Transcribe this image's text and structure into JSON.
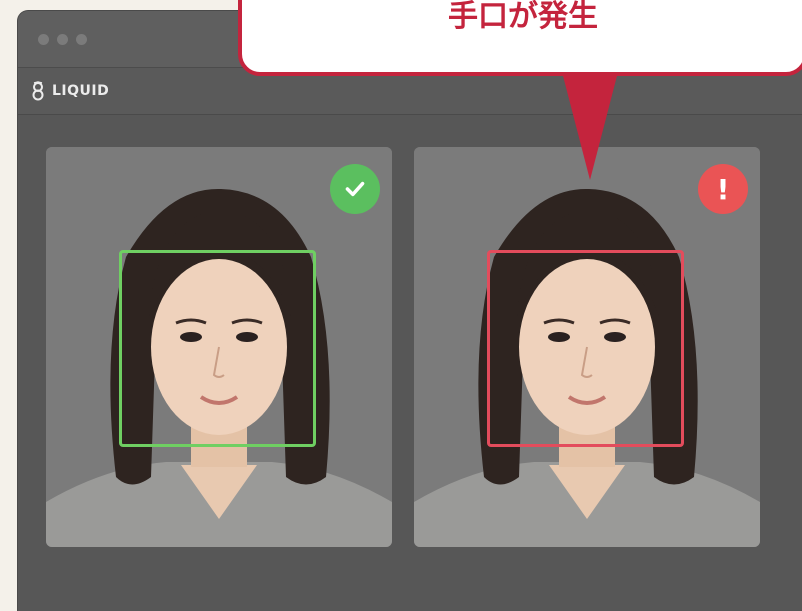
{
  "window": {
    "traffic_lights": [
      "window-dot",
      "window-dot",
      "window-dot"
    ]
  },
  "app": {
    "brand_label": "LIQUID",
    "brand_icon": "liquid-logo-icon"
  },
  "callout": {
    "text": "手口が発生",
    "color": "#c4243d"
  },
  "cards": [
    {
      "status": "ok",
      "badge_icon": "check-icon",
      "badge_color": "#5bbf5f",
      "frame_color": "#6fcf62"
    },
    {
      "status": "alert",
      "badge_icon": "exclamation-icon",
      "badge_text": "!",
      "badge_color": "#ea5455",
      "frame_color": "#e34c5c"
    }
  ]
}
